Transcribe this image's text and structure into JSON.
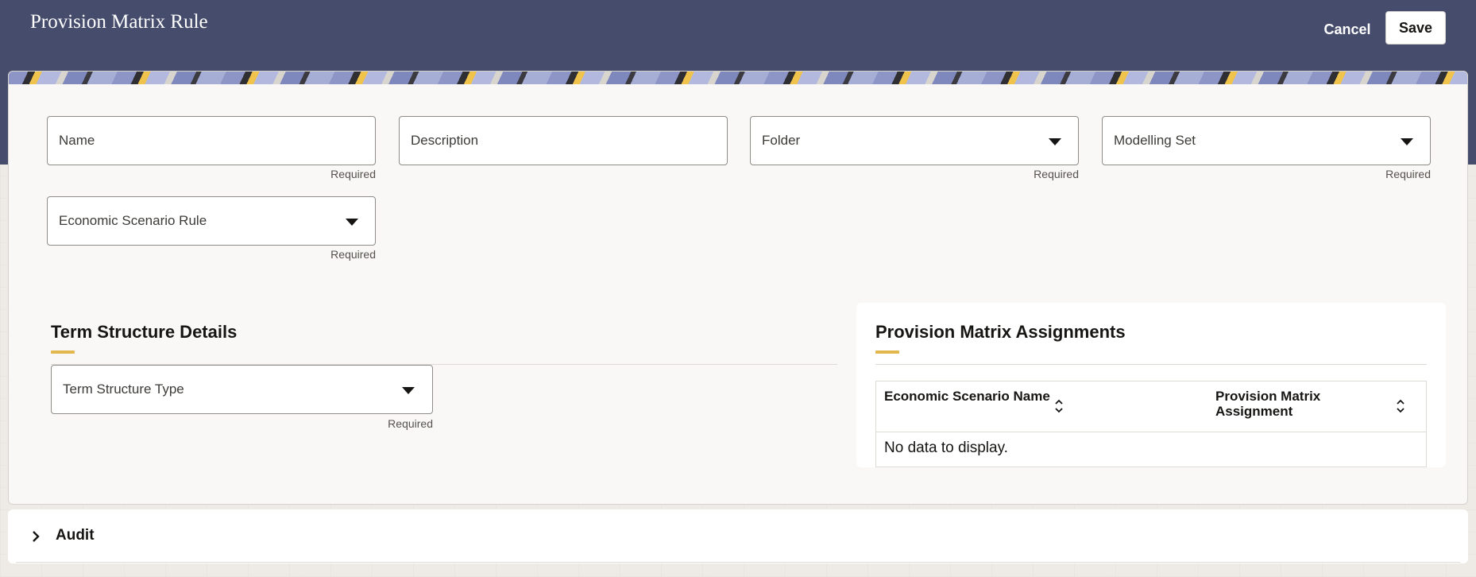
{
  "header": {
    "title": "Provision Matrix Rule",
    "cancel_label": "Cancel",
    "save_label": "Save"
  },
  "form": {
    "name_label": "Name",
    "description_label": "Description",
    "folder_label": "Folder",
    "modelling_set_label": "Modelling Set",
    "economic_scenario_rule_label": "Economic Scenario Rule",
    "required_text": "Required"
  },
  "term_structure": {
    "title": "Term Structure Details",
    "type_label": "Term Structure Type",
    "required_text": "Required"
  },
  "assignments": {
    "title": "Provision Matrix Assignments",
    "columns": [
      "Economic Scenario Name",
      "Provision Matrix Assignment"
    ],
    "empty_text": "No data to display."
  },
  "audit": {
    "label": "Audit"
  },
  "colors": {
    "header_bg": "#464c6c",
    "accent": "#e2b84e"
  }
}
